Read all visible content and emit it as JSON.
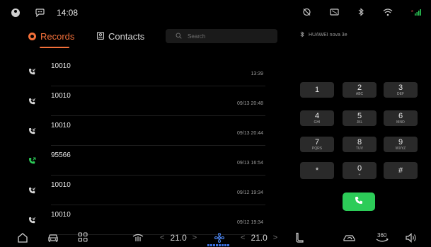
{
  "status_bar": {
    "time": "14:08",
    "icons": [
      "avatar-icon",
      "message-icon",
      "no-camera-icon",
      "screen-icon",
      "bluetooth-icon",
      "wifi-icon",
      "cellular-signal-icon"
    ]
  },
  "tabs": [
    {
      "label": "Records",
      "icon": "records-icon",
      "active": true
    },
    {
      "label": "Contacts",
      "icon": "contacts-icon",
      "active": false
    }
  ],
  "search": {
    "placeholder": "Search"
  },
  "device": {
    "name": "HUAWEI nova 3e",
    "icon": "bluetooth-icon"
  },
  "calls": [
    {
      "number": "10010",
      "time": "13:39",
      "type": "incoming"
    },
    {
      "number": "10010",
      "time": "09/13 20:48",
      "type": "incoming"
    },
    {
      "number": "10010",
      "time": "09/13 20:44",
      "type": "incoming"
    },
    {
      "number": "95566",
      "time": "09/13 16:54",
      "type": "outgoing"
    },
    {
      "number": "10010",
      "time": "09/12 19:34",
      "type": "incoming"
    },
    {
      "number": "10010",
      "time": "09/12 19:34",
      "type": "incoming"
    }
  ],
  "keypad": [
    {
      "digit": "1",
      "letters": ""
    },
    {
      "digit": "2",
      "letters": "ABC"
    },
    {
      "digit": "3",
      "letters": "DEF"
    },
    {
      "digit": "4",
      "letters": "GHI"
    },
    {
      "digit": "5",
      "letters": "JKL"
    },
    {
      "digit": "6",
      "letters": "MNO"
    },
    {
      "digit": "7",
      "letters": "PQRS"
    },
    {
      "digit": "8",
      "letters": "TUV"
    },
    {
      "digit": "9",
      "letters": "WXYZ"
    },
    {
      "digit": "*",
      "letters": ""
    },
    {
      "digit": "0",
      "letters": "+"
    },
    {
      "digit": "#",
      "letters": ""
    }
  ],
  "call_button": {
    "icon": "phone-icon",
    "color": "#2ccc58"
  },
  "bottom_bar": {
    "temp_left": "21.0",
    "temp_right": "21.0",
    "icons": [
      "home-icon",
      "car-icon",
      "apps-icon",
      "seat-heat-icon",
      "fan-icon",
      "seat-icon",
      "recirculation-icon",
      "360-view-icon",
      "volume-icon"
    ],
    "view360_label": "360"
  },
  "colors": {
    "accent": "#f3703a",
    "call_green": "#2ccc58",
    "incoming_icon": "#d8d8d8",
    "outgoing_icon": "#2ccc58"
  }
}
